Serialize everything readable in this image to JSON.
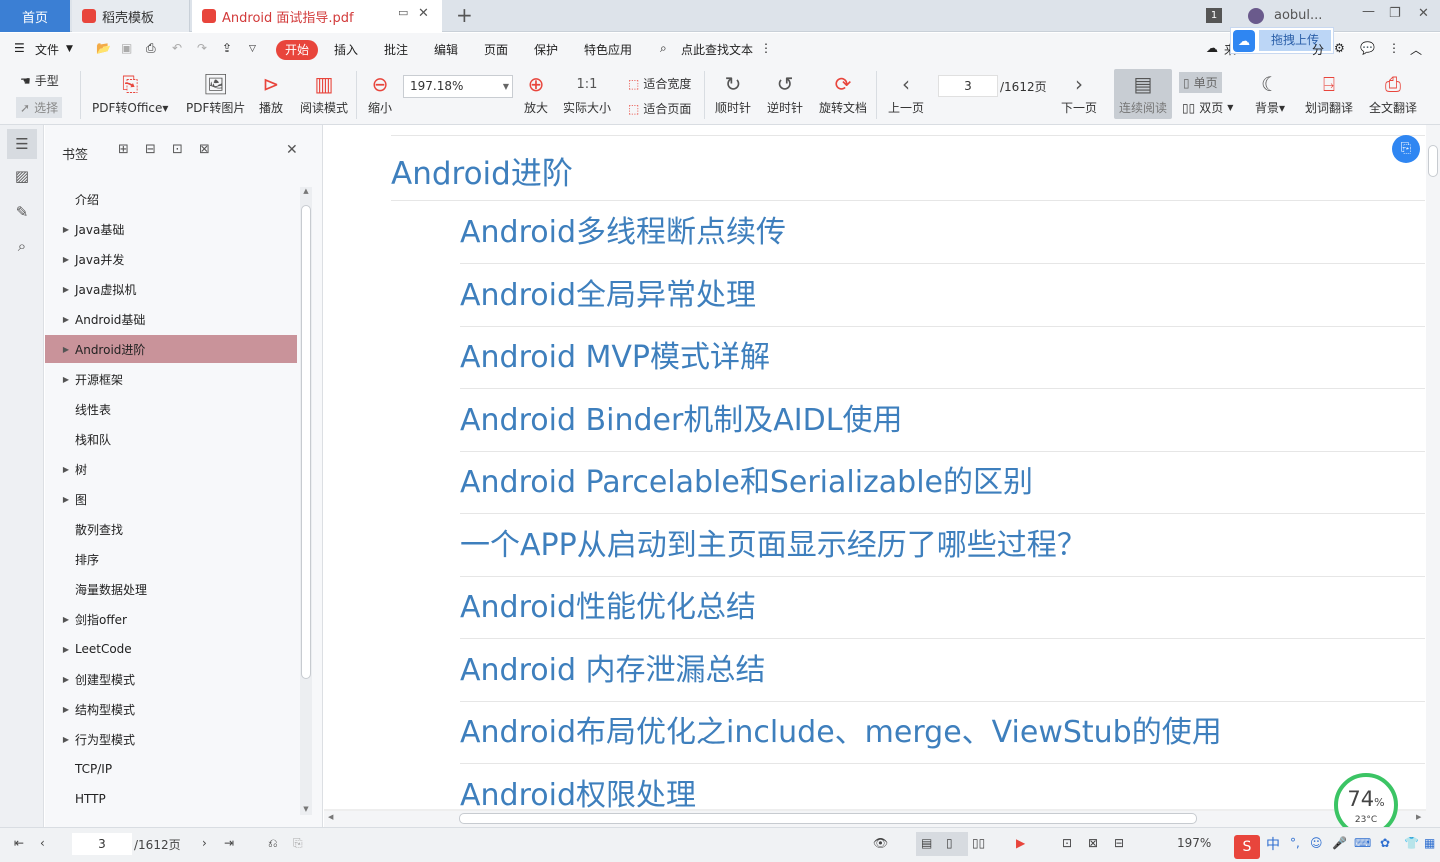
{
  "tabs": {
    "home": "首页",
    "template": "稻壳模板",
    "doc": "Android 面试指导.pdf",
    "badge": "1",
    "user": "aobul..."
  },
  "menu": {
    "file": "文件",
    "start": "开始",
    "items": [
      "插入",
      "批注",
      "编辑",
      "页面",
      "保护",
      "特色应用"
    ],
    "find": "点此查找文本",
    "upload": "拖拽上传",
    "partial_left": "来",
    "partial_right": "分"
  },
  "ribbon": {
    "hand": "手型",
    "select": "选择",
    "pdf_office": "PDF转Office",
    "pdf_image": "PDF转图片",
    "play": "播放",
    "read_mode": "阅读模式",
    "zoom_out": "缩小",
    "zoom_value": "197.18%",
    "zoom_in": "放大",
    "actual_size": "实际大小",
    "fit_width": "适合宽度",
    "fit_page": "适合页面",
    "clockwise": "顺时针",
    "counter": "逆时针",
    "rotate_doc": "旋转文档",
    "prev": "上一页",
    "page_value": "3",
    "page_total": "/1612页",
    "next": "下一页",
    "continuous": "连续阅读",
    "single": "单页",
    "double": "双页",
    "background": "背景",
    "translate_word": "划词翻译",
    "translate_full": "全文翻译"
  },
  "panel": {
    "title": "书签",
    "items": [
      {
        "label": "介绍",
        "arrow": false,
        "selected": false
      },
      {
        "label": "Java基础",
        "arrow": true,
        "selected": false
      },
      {
        "label": "Java并发",
        "arrow": true,
        "selected": false
      },
      {
        "label": "Java虚拟机",
        "arrow": true,
        "selected": false
      },
      {
        "label": "Android基础",
        "arrow": true,
        "selected": false
      },
      {
        "label": "Android进阶",
        "arrow": true,
        "selected": true
      },
      {
        "label": "开源框架",
        "arrow": true,
        "selected": false
      },
      {
        "label": "线性表",
        "arrow": false,
        "selected": false
      },
      {
        "label": "栈和队",
        "arrow": false,
        "selected": false
      },
      {
        "label": "树",
        "arrow": true,
        "selected": false
      },
      {
        "label": "图",
        "arrow": true,
        "selected": false
      },
      {
        "label": "散列查找",
        "arrow": false,
        "selected": false
      },
      {
        "label": "排序",
        "arrow": false,
        "selected": false
      },
      {
        "label": "海量数据处理",
        "arrow": false,
        "selected": false
      },
      {
        "label": "剑指offer",
        "arrow": true,
        "selected": false
      },
      {
        "label": "LeetCode",
        "arrow": true,
        "selected": false
      },
      {
        "label": "创建型模式",
        "arrow": true,
        "selected": false
      },
      {
        "label": "结构型模式",
        "arrow": true,
        "selected": false
      },
      {
        "label": "行为型模式",
        "arrow": true,
        "selected": false
      },
      {
        "label": "TCP/IP",
        "arrow": false,
        "selected": false
      },
      {
        "label": "HTTP",
        "arrow": false,
        "selected": false
      }
    ]
  },
  "document": {
    "heading": "Android进阶",
    "entries": [
      "Android多线程断点续传",
      "Android全局异常处理",
      "Android MVP模式详解",
      "Android Binder机制及AIDL使用",
      "Android Parcelable和Serializable的区别",
      "一个APP从启动到主页面显示经历了哪些过程？",
      "Android性能优化总结",
      "Android 内存泄漏总结",
      "Android布局优化之include、merge、ViewStub的使用",
      "Android权限处理"
    ],
    "link_color": "#3e7fbd"
  },
  "status": {
    "page_value": "3",
    "page_total": "/1612页",
    "zoom": "197%",
    "cpu": "74",
    "cpu_unit": "%",
    "temp": "23°C",
    "ime": "中"
  }
}
